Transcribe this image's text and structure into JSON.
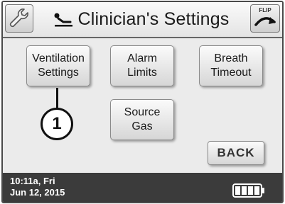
{
  "header": {
    "title": "Clinician's Settings",
    "wrench_icon": "wrench-icon",
    "person_icon": "reclining-person-icon",
    "flip_label": "FLIP",
    "flip_icon": "flip-arrow-icon"
  },
  "menu": {
    "ventilation": "Ventilation\nSettings",
    "alarm": "Alarm\nLimits",
    "breath": "Breath\nTimeout",
    "source": "Source\nGas"
  },
  "callout": {
    "number": "1"
  },
  "back_label": "BACK",
  "status": {
    "time_line1": "10:11a, Fri",
    "time_line2": "Jun 12, 2015",
    "battery_icon": "battery-full-icon"
  },
  "colors": {
    "status_bar": "#3b3b3b",
    "button_face": "#e6e6e6",
    "screen_bg": "#ebebeb"
  }
}
